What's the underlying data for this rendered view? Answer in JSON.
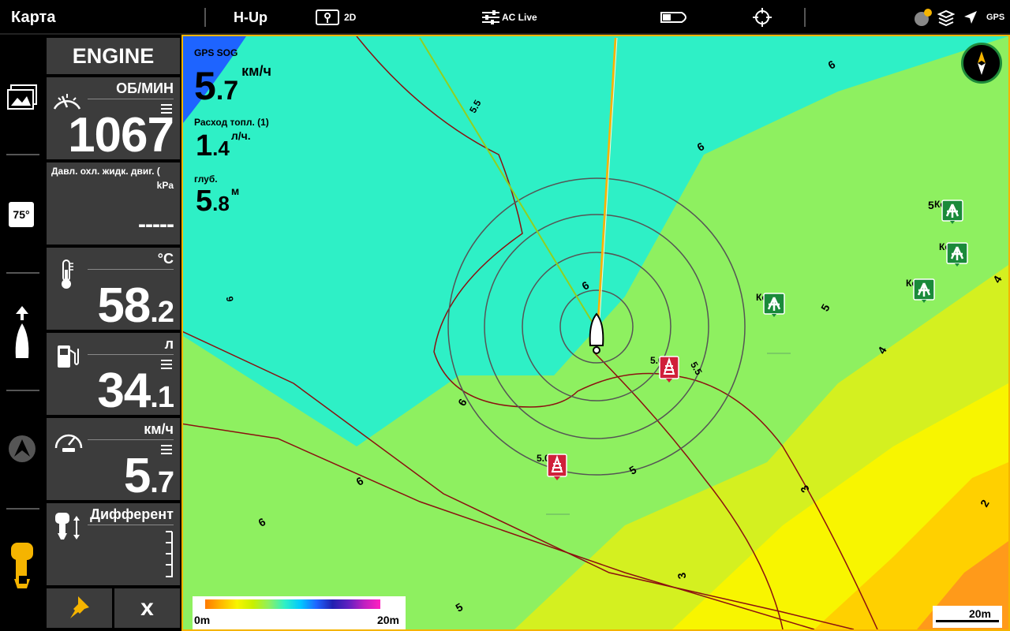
{
  "topbar": {
    "title": "Карта",
    "orientation": "H-Up",
    "view_mode": "2D",
    "ac_live": "AC Live",
    "gps_label": "GPS"
  },
  "engine": {
    "header": "ENGINE",
    "rpm_unit": "ОБ/МИН",
    "rpm_value": "1067",
    "coolant_label": "Давл. охл. жидк. двиг. (",
    "coolant_unit": "kPa",
    "coolant_value": "-----",
    "temp_unit": "°C",
    "temp_int": "58",
    "temp_dec": ".2",
    "fuel_unit": "л",
    "fuel_int": "34",
    "fuel_dec": ".1",
    "speed_unit": "км/ч",
    "speed_int": "5",
    "speed_dec": ".7",
    "trim_label": "Дифферент",
    "close_label": "x"
  },
  "leftbar": {
    "temp_badge": "75°"
  },
  "overlay": {
    "sog_label": "GPS SOG",
    "sog_int": "5",
    "sog_dec": ".7",
    "sog_unit": "км/ч",
    "fuel_rate_label": "Расход топл. (1)",
    "fuel_rate_int": "1",
    "fuel_rate_dec": ".4",
    "fuel_rate_unit": "л/ч.",
    "depth_label": "глуб.",
    "depth_int": "5",
    "depth_dec": ".8",
    "depth_unit": "м"
  },
  "map": {
    "markers": [
      {
        "label": "Корч",
        "type": "snag"
      },
      {
        "label": "Корч",
        "type": "snag"
      },
      {
        "label": "Корч",
        "type": "snag"
      },
      {
        "label": "Корч",
        "type": "snag"
      },
      {
        "label": "5.0",
        "type": "depth"
      },
      {
        "label": "5.0 м.",
        "type": "depth"
      }
    ],
    "contour_labels": [
      "6",
      "6",
      "5.5",
      "6",
      "6",
      "6",
      "5",
      "4",
      "5.5",
      "6",
      "5",
      "3",
      "3",
      "4",
      "2",
      "5",
      "6",
      "5"
    ],
    "scale_left": "0m",
    "scale_right": "20m",
    "scale_bar": "20m"
  },
  "colors": {
    "accent": "#f5b400",
    "shallow_orange": "#ff9a1a",
    "yellow": "#f8f500",
    "green": "#8ef060",
    "cyan": "#2ef0c6",
    "deep_blue": "#1e64ff"
  }
}
